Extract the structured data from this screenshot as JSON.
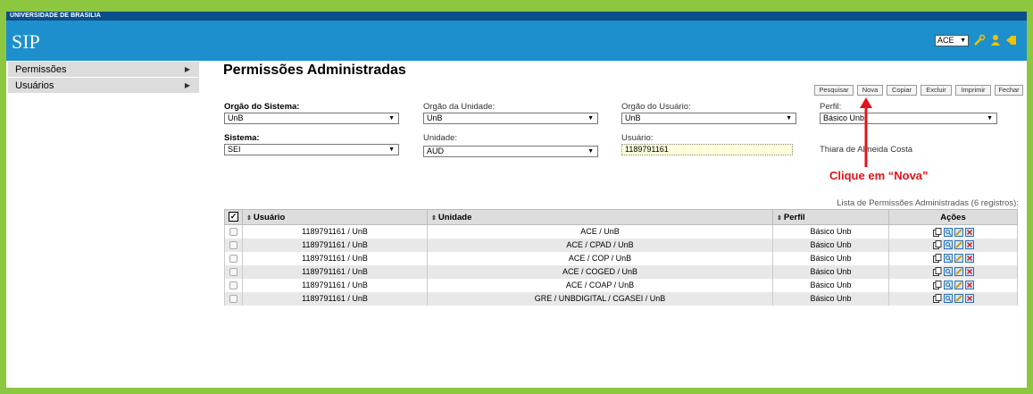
{
  "header": {
    "university": "UNIVERSIDADE DE BRASILIA",
    "app_title": "SIP",
    "org_selected": "ACE",
    "icons": [
      "tools-icon",
      "user-icon",
      "exit-icon"
    ]
  },
  "sidebar": {
    "items": [
      {
        "label": "Permissões"
      },
      {
        "label": "Usuários"
      }
    ]
  },
  "main": {
    "title": "Permissões Administradas",
    "buttons": {
      "pesquisar": "Pesquisar",
      "nova": "Nova",
      "copiar": "Copiar",
      "excluir": "Excluir",
      "imprimir": "Imprimir",
      "fechar": "Fechar"
    },
    "filters": {
      "orgao_sistema": {
        "label": "Orgão do Sistema:",
        "value": "UnB"
      },
      "orgao_unidade": {
        "label": "Orgão da Unidade:",
        "value": "UnB"
      },
      "orgao_usuario": {
        "label": "Orgão do Usuário:",
        "value": "UnB"
      },
      "perfil": {
        "label": "Perfil:",
        "value": "Básico Unb"
      },
      "sistema": {
        "label": "Sistema:",
        "value": "SEI"
      },
      "unidade": {
        "label": "Unidade:",
        "value": "AUD"
      },
      "usuario": {
        "label": "Usuário:",
        "value": "1189791161"
      },
      "usuario_nome": "Thiara de Almeida Costa"
    },
    "annotation": "Clique em “Nova”",
    "list_caption": "Lista de Permissões Administradas (6 registros):",
    "table": {
      "headers": {
        "usuario": "Usuário",
        "unidade": "Unidade",
        "perfil": "Perfil",
        "acoes": "Ações"
      },
      "rows": [
        {
          "usuario": "1189791161 / UnB",
          "unidade": "ACE / UnB",
          "perfil": "Básico Unb"
        },
        {
          "usuario": "1189791161 / UnB",
          "unidade": "ACE / CPAD / UnB",
          "perfil": "Básico Unb"
        },
        {
          "usuario": "1189791161 / UnB",
          "unidade": "ACE / COP / UnB",
          "perfil": "Básico Unb"
        },
        {
          "usuario": "1189791161 / UnB",
          "unidade": "ACE / COGED / UnB",
          "perfil": "Básico Unb"
        },
        {
          "usuario": "1189791161 / UnB",
          "unidade": "ACE / COAP / UnB",
          "perfil": "Básico Unb"
        },
        {
          "usuario": "1189791161 / UnB",
          "unidade": "GRE / UNBDIGITAL / CGASEI / UnB",
          "perfil": "Básico Unb"
        }
      ]
    }
  },
  "colors": {
    "page_frame": "#8dc63f",
    "header": "#1d8fcd",
    "header_dark": "#0b4f8a",
    "annotation": "#e0141a"
  }
}
